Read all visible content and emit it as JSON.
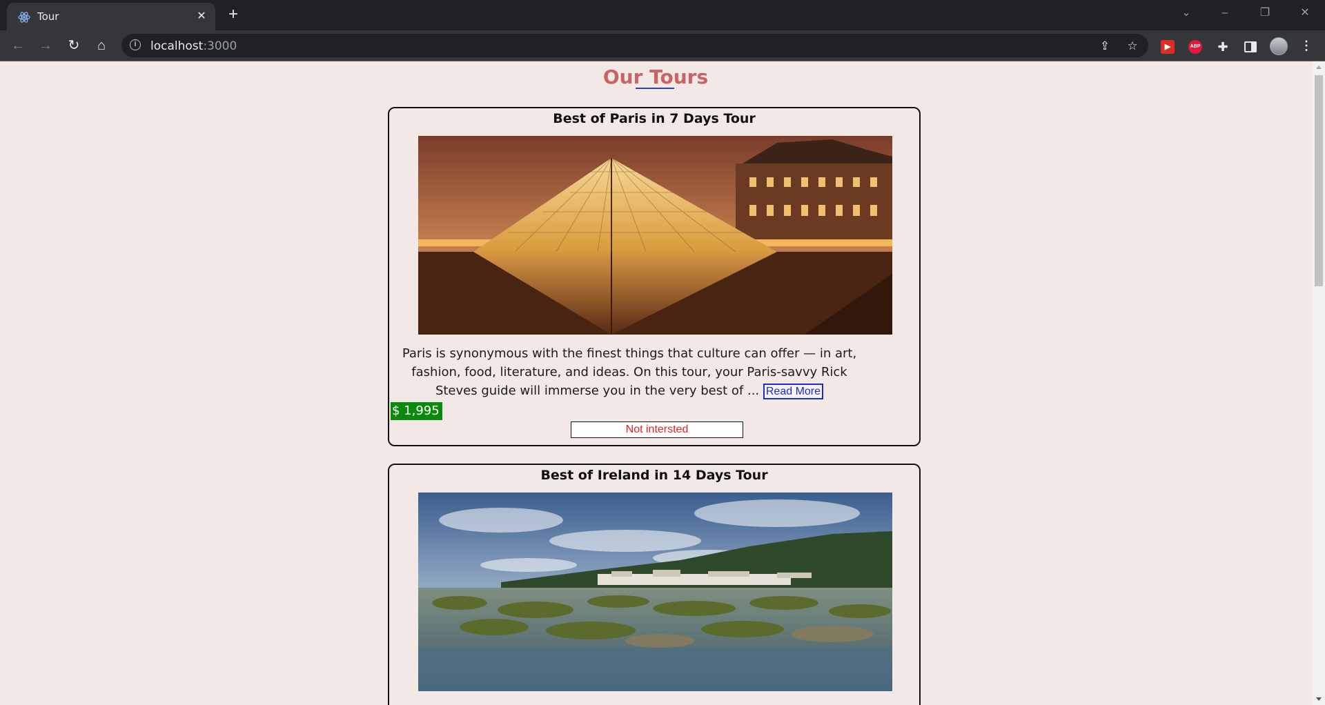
{
  "browser": {
    "tab_title": "Tour",
    "url_host": "localhost",
    "url_port": ":3000",
    "icons": {
      "favicon": "react-atom-icon",
      "close": "close-icon",
      "new_tab": "plus-icon",
      "back": "arrow-left-icon",
      "forward": "arrow-right-icon",
      "reload": "reload-icon",
      "home": "home-icon",
      "site_info": "info-icon",
      "share": "share-icon",
      "bookmark": "star-icon",
      "menu": "more-vertical-icon"
    },
    "extensions": [
      "red-extension-icon",
      "adblock-plus-icon",
      "puzzle-icon",
      "side-panel-icon"
    ],
    "abp_label": "ABP"
  },
  "page": {
    "heading": "Our Tours",
    "colors": {
      "background": "#f2e8e6",
      "heading": "#c86464",
      "underline": "#2b3fc8",
      "price_bg": "#0a8a0a",
      "not_interested_text": "#e0202a",
      "read_more": "#1d2bc6"
    }
  },
  "tours": [
    {
      "title": "Best of Paris in 7 Days Tour",
      "image": "louvre-pyramid-night-photo",
      "description": "Paris is synonymous with the finest things that culture can offer — in art, fashion, food, literature, and ideas. On this tour, your Paris-savvy Rick Steves guide will immerse you in the very best of ...",
      "read_more_label": "Read More",
      "price": "$ 1,995",
      "not_interested_label": "Not intersted"
    },
    {
      "title": "Best of Ireland in 14 Days Tour",
      "image": "ireland-coast-photo"
    }
  ]
}
